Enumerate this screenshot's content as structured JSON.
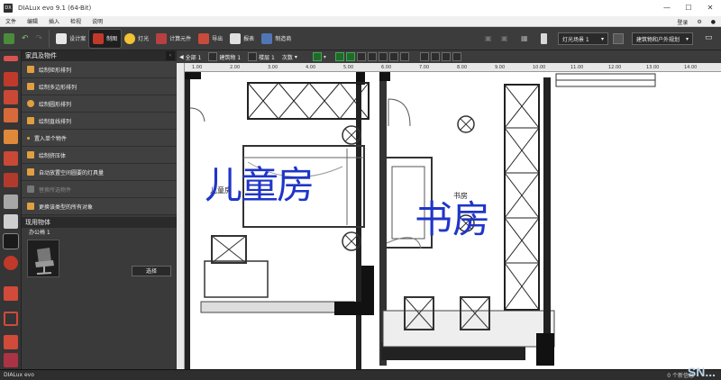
{
  "window": {
    "title": "DIALux evo 9.1  (64-Bit)",
    "icon_text": "DX"
  },
  "menu": {
    "items": [
      "文件",
      "编辑",
      "插入",
      "检视",
      "说明"
    ],
    "login": "登录"
  },
  "ribbon": {
    "buttons": [
      "设计案",
      "制图",
      "灯光",
      "计算元件",
      "导出",
      "报表",
      "制造商"
    ],
    "scene_select": "灯光场景 1",
    "planning_select": "建筑物和户外规划"
  },
  "panel": {
    "title": "家具及物件",
    "items": [
      {
        "label": "绘制矩形排列",
        "disabled": false
      },
      {
        "label": "绘制多边形排列",
        "disabled": false
      },
      {
        "label": "绘制圆形排列",
        "disabled": false
      },
      {
        "label": "绘制直线排列",
        "disabled": false
      },
      {
        "label": "置入单个物件",
        "disabled": false
      },
      {
        "label": "绘制挤压体",
        "disabled": false
      },
      {
        "label": "自动放置空间圆要的灯具量",
        "disabled": false
      },
      {
        "label": "替换所选物件",
        "disabled": true
      },
      {
        "label": "更换该类型的所有对象",
        "disabled": false
      }
    ],
    "used_objects_title": "现用物体",
    "object_name": "办公椅 1",
    "select_button": "选择"
  },
  "viewbar": {
    "chips": [
      "全部 1",
      "建筑物 1",
      "楼层 1",
      "次数"
    ]
  },
  "ruler": {
    "ticks": [
      "1.00",
      "2.00",
      "3.00",
      "4.00",
      "5.00",
      "6.00",
      "7.00",
      "8.00",
      "9.00",
      "10.00",
      "11.00",
      "12.00",
      "13.00",
      "14.00"
    ]
  },
  "plan": {
    "room1_label_big": "儿童房",
    "room2_label_big": "书房",
    "room1_label_small": "儿童房",
    "room2_label_small": "书房"
  },
  "status": {
    "brand": "DIALux evo",
    "messages": "0 个新信息",
    "watermark": "SN..."
  },
  "colors": {
    "accent_green": "#1f6b2a",
    "handwriting_blue": "#1f35c8"
  }
}
